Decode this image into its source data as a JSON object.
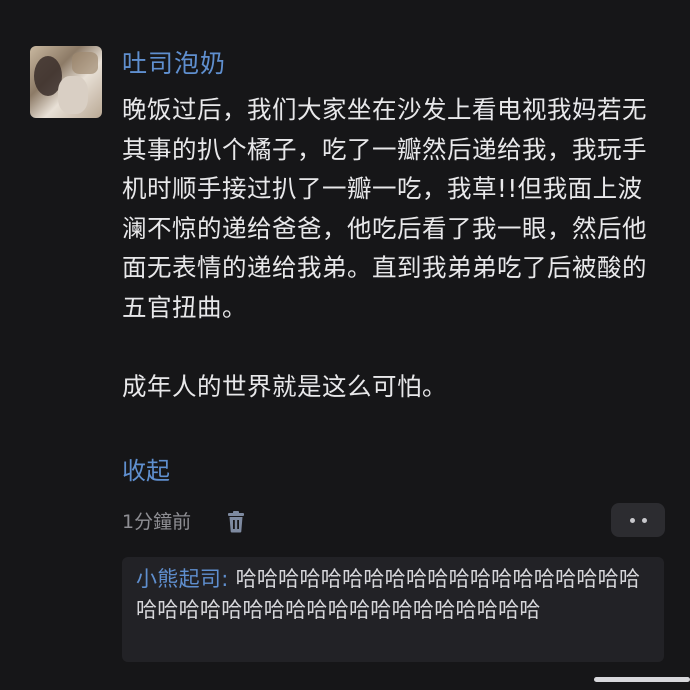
{
  "comment": {
    "username": "吐司泡奶",
    "body": "晚饭过后，我们大家坐在沙发上看电视我妈若无其事的扒个橘子，吃了一瓣然后递给我，我玩手机时顺手接过扒了一瓣一吃，我草!!但我面上波澜不惊的递给爸爸，他吃后看了我一眼，然后他面无表情的递给我弟。直到我弟弟吃了后被酸的五官扭曲。\n\n成年人的世界就是这么可怕。",
    "collapse_label": "收起",
    "timestamp": "1分鐘前",
    "delete_icon": "trash-icon",
    "more_icon": "more-dots-icon"
  },
  "reply": {
    "username": "小熊起司",
    "separator": ":",
    "text": " 哈哈哈哈哈哈哈哈哈哈哈哈哈哈哈哈哈哈哈哈哈哈哈哈哈哈哈哈哈哈哈哈哈哈哈哈哈哈"
  },
  "colors": {
    "background": "#161618",
    "link_blue": "#5f8fcf",
    "body_text": "#e8e8ea",
    "muted_text": "#8e8e93",
    "reply_bg": "#222226"
  }
}
